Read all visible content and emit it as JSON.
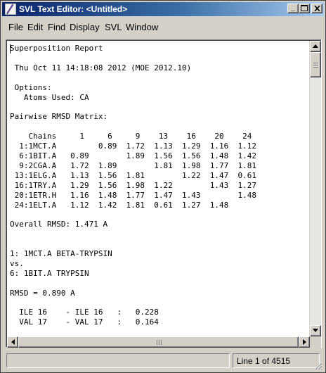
{
  "window": {
    "title": "SVL Text Editor: <Untitled>",
    "title_color": "#ffffff",
    "titlebar_color": "#0a246a"
  },
  "menubar": {
    "items": [
      {
        "label": "File"
      },
      {
        "label": "Edit"
      },
      {
        "label": "Find"
      },
      {
        "label": "Display"
      },
      {
        "label": "SVL"
      },
      {
        "label": "Window"
      }
    ]
  },
  "editor": {
    "text": "Superposition Report\n\n Thu Oct 11 14:18:08 2012 (MOE 2012.10)\n\n Options:\n   Atoms Used: CA\n\nPairwise RMSD Matrix:\n\n    Chains     1     6     9    13    16    20    24\n  1:1MCT.A         0.89  1.72  1.13  1.29  1.16  1.12\n  6:1BIT.A   0.89        1.89  1.56  1.56  1.48  1.42\n  9:2CGA.A   1.72  1.89        1.81  1.98  1.77  1.81\n 13:1ELG.A   1.13  1.56  1.81        1.22  1.47  0.61\n 16:1TRY.A   1.29  1.56  1.98  1.22        1.43  1.27\n 20:1ETR.H   1.16  1.48  1.77  1.47  1.43        1.48\n 24:1ELT.A   1.12  1.42  1.81  0.61  1.27  1.48\n\nOverall RMSD: 1.471 A\n\n\n1: 1MCT.A BETA-TRYPSIN\nvs.\n6: 1BIT.A TRYPSIN\n\nRMSD = 0.890 A\n\n  ILE 16    - ILE 16   :   0.228\n  VAL 17    - VAL 17   :   0.164"
  },
  "status": {
    "message": "",
    "position": "Line 1 of 4515"
  },
  "icons": {
    "app": "svl-app-icon",
    "minimize": "minimize-icon",
    "maximize": "maximize-icon",
    "close": "close-icon"
  }
}
